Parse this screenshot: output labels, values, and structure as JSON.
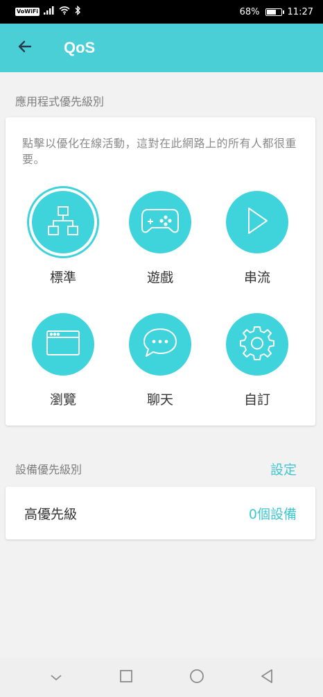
{
  "status_bar": {
    "network_badge": "VoWiFi",
    "battery_level": "68%",
    "battery_fraction": 0.68,
    "time": "11:27"
  },
  "header": {
    "title": "QoS",
    "back_icon": "arrow-left-icon"
  },
  "app_priority": {
    "section_title": "應用程式優先級別",
    "description": "點擊以優化在線活動，這對在此網路上的所有人都很重要。",
    "items": [
      {
        "label": "標準",
        "icon": "network-tree-icon",
        "selected": true
      },
      {
        "label": "遊戲",
        "icon": "gamepad-icon",
        "selected": false
      },
      {
        "label": "串流",
        "icon": "play-icon",
        "selected": false
      },
      {
        "label": "瀏覽",
        "icon": "browser-window-icon",
        "selected": false
      },
      {
        "label": "聊天",
        "icon": "chat-bubble-icon",
        "selected": false
      },
      {
        "label": "自訂",
        "icon": "gear-icon",
        "selected": false
      }
    ]
  },
  "device_priority": {
    "section_title": "設備優先級別",
    "action_label": "設定",
    "row_title": "高優先級",
    "row_value": "0個設備"
  },
  "nav_bar": {
    "back": "triangle-back-icon",
    "home": "circle-home-icon",
    "recents": "square-recents-icon",
    "hide": "chevron-down-icon"
  },
  "colors": {
    "accent": "#4acfd6",
    "icon_circle": "#3fd3dc",
    "link": "#3fc7d0"
  }
}
